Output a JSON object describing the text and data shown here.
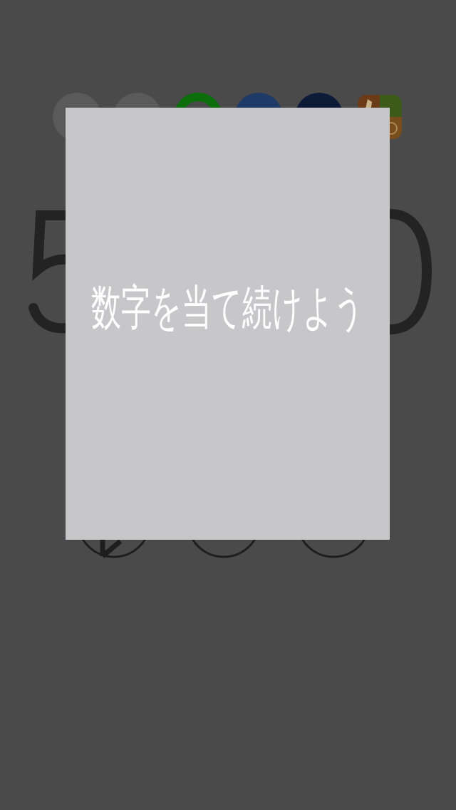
{
  "top_icons": [
    {
      "kind": "circle",
      "color": "#5a5a5a"
    },
    {
      "kind": "circle",
      "color": "#5a5a5a"
    },
    {
      "kind": "ring",
      "color": "#0b6e0b"
    },
    {
      "kind": "circle",
      "color": "#1e3a66"
    },
    {
      "kind": "circle",
      "color": "#0d1a38"
    },
    {
      "kind": "app"
    }
  ],
  "bottom_buttons": [
    {
      "kind": "pencil"
    },
    {
      "kind": "plain"
    },
    {
      "kind": "plain"
    }
  ],
  "dialog": {
    "message": "数字を当て続けよう"
  }
}
